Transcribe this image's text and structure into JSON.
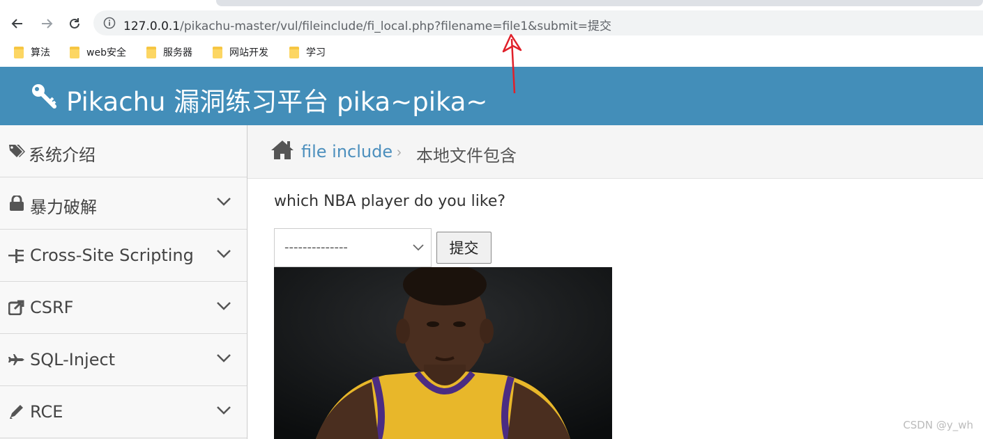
{
  "browser": {
    "url_host": "127.0.0.1",
    "url_path": "/pikachu-master/vul/fileinclude/fi_local.php?filename=file1&submit=提交",
    "bookmarks": [
      {
        "label": "算法"
      },
      {
        "label": "web安全"
      },
      {
        "label": "服务器"
      },
      {
        "label": "网站开发"
      },
      {
        "label": "学习"
      }
    ]
  },
  "header": {
    "title": "Pikachu 漏洞练习平台 pika~pika~",
    "icon": "key-icon",
    "bg_color": "#438eb9"
  },
  "sidebar": {
    "items": [
      {
        "label": "系统介绍",
        "icon": "tags-icon",
        "expandable": false
      },
      {
        "label": "暴力破解",
        "icon": "lock-icon",
        "expandable": true
      },
      {
        "label": "Cross-Site Scripting",
        "icon": "list-icon",
        "expandable": true
      },
      {
        "label": "CSRF",
        "icon": "share-icon",
        "expandable": true
      },
      {
        "label": "SQL-Inject",
        "icon": "plane-icon",
        "expandable": true
      },
      {
        "label": "RCE",
        "icon": "pencil-icon",
        "expandable": true
      }
    ]
  },
  "breadcrumb": {
    "link": "file include",
    "separator": "›",
    "current": "本地文件包含"
  },
  "content": {
    "question": "which NBA player do you like?",
    "select_value": "--------------",
    "submit_label": "提交"
  },
  "watermark": "CSDN @y_wh",
  "accent_color": "#4c8fbd"
}
